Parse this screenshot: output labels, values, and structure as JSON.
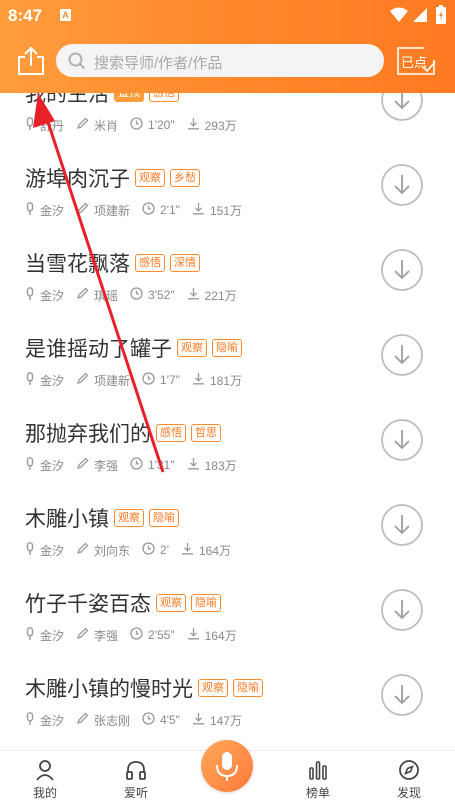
{
  "status_bar": {
    "time": "8:47",
    "notification_badge": "A"
  },
  "header": {
    "search_placeholder": "搜索导师/作者/作品",
    "checkin_label": "已点"
  },
  "colors": {
    "accent": "#ff8a2c",
    "accent_light": "#ff9d3c",
    "tag_text": "#ff7a22"
  },
  "items": [
    {
      "title": "我的生活",
      "tags": [
        {
          "label": "置顶",
          "filled": true
        },
        {
          "label": "感悟",
          "filled": false
        }
      ],
      "narrator": "舒丹",
      "author": "米肖",
      "duration": "1'20\"",
      "downloads": "293万"
    },
    {
      "title": "游埠肉沉子",
      "tags": [
        {
          "label": "观察",
          "filled": false
        },
        {
          "label": "乡愁",
          "filled": false
        }
      ],
      "narrator": "金汐",
      "author": "项建新",
      "duration": "2'1\"",
      "downloads": "151万"
    },
    {
      "title": "当雪花飘落",
      "tags": [
        {
          "label": "感悟",
          "filled": false
        },
        {
          "label": "深情",
          "filled": false
        }
      ],
      "narrator": "金汐",
      "author": "琪瑶",
      "duration": "3'52\"",
      "downloads": "221万"
    },
    {
      "title": "是谁摇动了罐子",
      "tags": [
        {
          "label": "观察",
          "filled": false
        },
        {
          "label": "隐喻",
          "filled": false
        }
      ],
      "narrator": "金汐",
      "author": "项建新",
      "duration": "1'7\"",
      "downloads": "181万"
    },
    {
      "title": "那抛弃我们的",
      "tags": [
        {
          "label": "感悟",
          "filled": false
        },
        {
          "label": "哲思",
          "filled": false
        }
      ],
      "narrator": "金汐",
      "author": "李强",
      "duration": "1'31\"",
      "downloads": "183万"
    },
    {
      "title": "木雕小镇",
      "tags": [
        {
          "label": "观察",
          "filled": false
        },
        {
          "label": "隐喻",
          "filled": false
        }
      ],
      "narrator": "金汐",
      "author": "刘向东",
      "duration": "2'",
      "downloads": "164万"
    },
    {
      "title": "竹子千姿百态",
      "tags": [
        {
          "label": "观察",
          "filled": false
        },
        {
          "label": "隐喻",
          "filled": false
        }
      ],
      "narrator": "金汐",
      "author": "李强",
      "duration": "2'55\"",
      "downloads": "164万"
    },
    {
      "title": "木雕小镇的慢时光",
      "tags": [
        {
          "label": "观察",
          "filled": false
        },
        {
          "label": "隐喻",
          "filled": false
        }
      ],
      "narrator": "金汐",
      "author": "张志刚",
      "duration": "4'5\"",
      "downloads": "147万"
    }
  ],
  "tabbar": {
    "tabs": [
      {
        "label": "我的",
        "icon": "person-icon"
      },
      {
        "label": "爱听",
        "icon": "headphones-icon"
      },
      {
        "label": "榜单",
        "icon": "chart-bars-icon"
      },
      {
        "label": "发现",
        "icon": "compass-icon"
      }
    ],
    "center_icon": "microphone-icon"
  }
}
